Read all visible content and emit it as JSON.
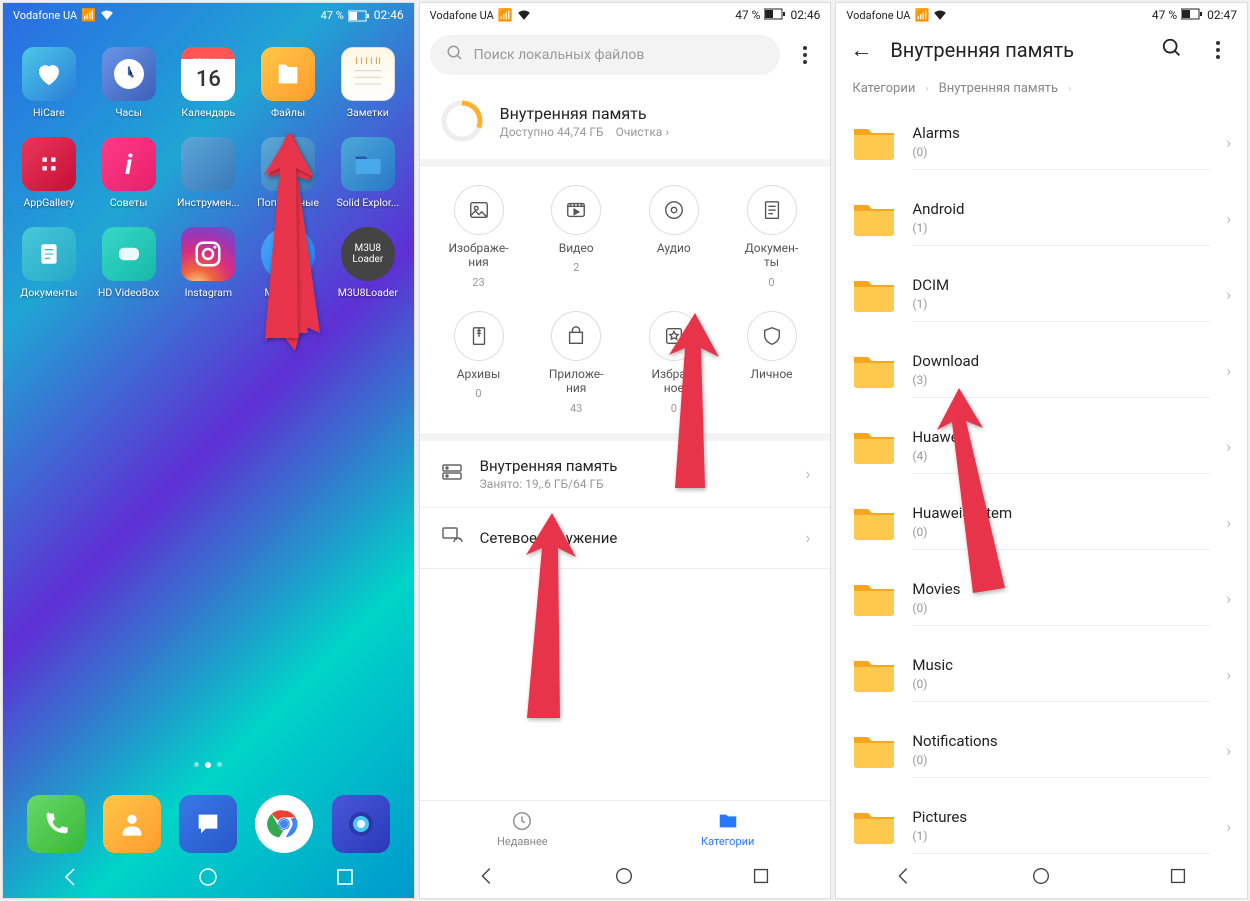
{
  "status": {
    "carrier": "Vodafone UA",
    "battery_pct": "47 %",
    "time1": "02:46",
    "time2": "02:46",
    "time3": "02:47"
  },
  "home": {
    "apps": [
      {
        "label": "HiCare"
      },
      {
        "label": "Часы"
      },
      {
        "label": "Календарь",
        "weekday": "вторник",
        "day": "16"
      },
      {
        "label": "Файлы"
      },
      {
        "label": "Заметки"
      },
      {
        "label": "AppGallery"
      },
      {
        "label": "Советы"
      },
      {
        "label": "Инструмен..."
      },
      {
        "label": "Популярные"
      },
      {
        "label": "Solid Explor..."
      },
      {
        "label": "Документы"
      },
      {
        "label": "HD VideoBox"
      },
      {
        "label": "Instagram"
      },
      {
        "label": "MX Player"
      },
      {
        "label": "M3U8Loader",
        "badge": "M3U8\nLoader"
      }
    ]
  },
  "files": {
    "search_placeholder": "Поиск локальных файлов",
    "storage_title": "Внутренняя память",
    "storage_sub": "Доступно 44,74 ГБ",
    "cleanup": "Очистка",
    "categories": [
      {
        "label": "Изображе-\nния",
        "count": "23"
      },
      {
        "label": "Видео",
        "count": "2"
      },
      {
        "label": "Аудио",
        "count": ""
      },
      {
        "label": "Докумен-\nты",
        "count": "0"
      },
      {
        "label": "Архивы",
        "count": "0"
      },
      {
        "label": "Приложе-\nния",
        "count": "43"
      },
      {
        "label": "Избран-\nное",
        "count": "0"
      },
      {
        "label": "Личное",
        "count": ""
      }
    ],
    "internal": {
      "title": "Внутренняя память",
      "sub": "Занято: 19,.6 ГБ/64 ГБ"
    },
    "network": {
      "title": "Сетевое окружение"
    },
    "tab_recent": "Недавнее",
    "tab_categories": "Категории"
  },
  "browser": {
    "title": "Внутренняя память",
    "crumb1": "Категории",
    "crumb2": "Внутренняя память",
    "folders": [
      {
        "name": "Alarms",
        "count": "(0)"
      },
      {
        "name": "Android",
        "count": "(1)"
      },
      {
        "name": "DCIM",
        "count": "(1)"
      },
      {
        "name": "Download",
        "count": "(3)"
      },
      {
        "name": "Huawe",
        "count": "(4)"
      },
      {
        "name": "HuaweiSystem",
        "count": "(0)"
      },
      {
        "name": "Movies",
        "count": "(0)"
      },
      {
        "name": "Music",
        "count": "(0)"
      },
      {
        "name": "Notifications",
        "count": "(0)"
      },
      {
        "name": "Pictures",
        "count": "(1)"
      }
    ]
  }
}
